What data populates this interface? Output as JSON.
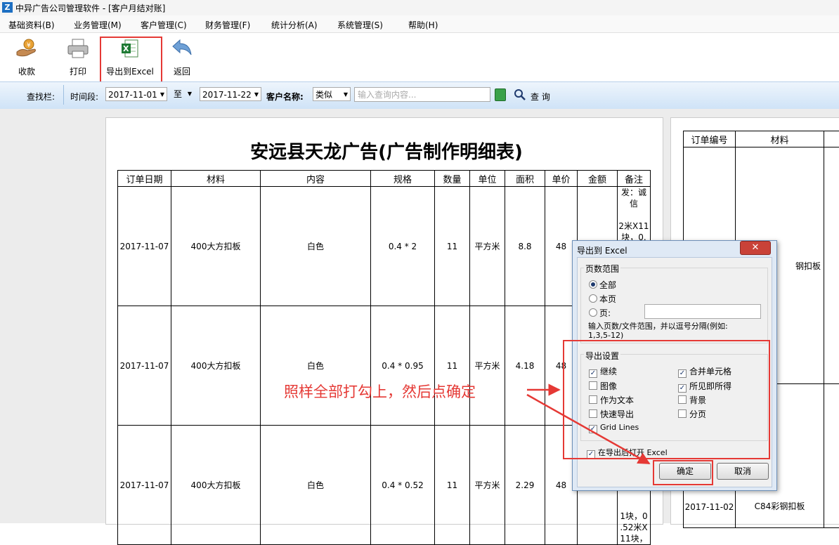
{
  "window": {
    "title": "中异广告公司管理软件 - [客户月结对账]"
  },
  "menu": [
    "基础资料(B)",
    "业务管理(M)",
    "客户管理(C)",
    "财务管理(F)",
    "统计分析(A)",
    "系统管理(S)",
    "帮助(H)"
  ],
  "toolbar": {
    "collect": "收款",
    "print": "打印",
    "export": "导出到Excel",
    "back": "返回"
  },
  "search": {
    "bar_label": "查找栏:",
    "period_label": "时间段:",
    "start": "2017-11-01",
    "to": "至",
    "end": "2017-11-22",
    "customer_label": "客户名称:",
    "match_type": "类似",
    "placeholder": "输入查询内容...",
    "query_label": "查 询"
  },
  "report": {
    "title": "安远县天龙广告(广告制作明细表)",
    "headers": [
      "订单日期",
      "材料",
      "内容",
      "规格",
      "数量",
      "单位",
      "面积",
      "单价",
      "金额",
      "备注"
    ],
    "rows": [
      {
        "date": "2017-11-07",
        "material": "400大方扣板",
        "content": "白色",
        "spec": "0.4 * 2",
        "qty": "11",
        "unit": "平方米",
        "area": "8.8",
        "price": "48",
        "remark": "发：诚\n信\n\n2米X11\n块，0."
      },
      {
        "date": "2017-11-07",
        "material": "400大方扣板",
        "content": "白色",
        "spec": "0.4 * 0.95",
        "qty": "11",
        "unit": "平方米",
        "area": "4.18",
        "price": "48",
        "remark": ""
      },
      {
        "date": "2017-11-07",
        "material": "400大方扣板",
        "content": "白色",
        "spec": "0.4 * 0.52",
        "qty": "11",
        "unit": "平方米",
        "area": "2.29",
        "price": "48",
        "remark": "1块，0\n.52米X\n11块，"
      }
    ]
  },
  "report2": {
    "headers": [
      "订单编号",
      "材料"
    ],
    "row1_material": "钢扣板",
    "row2_date": "2017-11-02",
    "row2_material": "C84彩钢扣板"
  },
  "dialog": {
    "title": "导出到 Excel",
    "close": "✕",
    "range_title": "页数范围",
    "all": "全部",
    "current": "本页",
    "pages": "页:",
    "hint": "输入页数/文件范围，并以逗号分隔(例如:\n1,3,5-12)",
    "settings_title": "导出设置",
    "continuous": "继续",
    "merge": "合并单元格",
    "image": "图像",
    "wysiwyg": "所见即所得",
    "as_text": "作为文本",
    "background": "背景",
    "fast": "快速导出",
    "paging": "分页",
    "gridlines": "Grid Lines",
    "open_after": "在导出后打开 Excel",
    "ok": "确定",
    "cancel": "取消"
  },
  "annotation": "照样全部打勾上，然后点确定",
  "colors": {
    "accent_red": "#e53935",
    "toolbar_blue": "#cfe3f7"
  }
}
